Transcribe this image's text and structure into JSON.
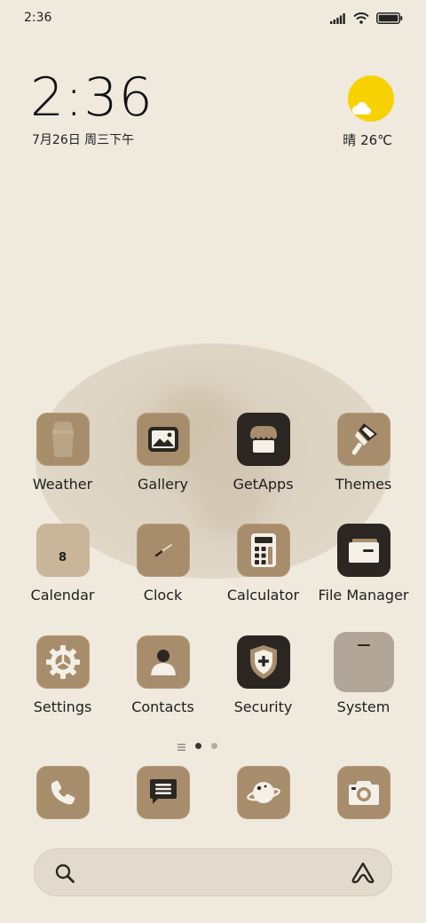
{
  "status_bar": {
    "time": "2:36"
  },
  "widget": {
    "time": "2:36",
    "date": "7月26日 周三下午",
    "weather": "晴 26℃"
  },
  "apps": [
    {
      "label": "Weather"
    },
    {
      "label": "Gallery"
    },
    {
      "label": "GetApps"
    },
    {
      "label": "Themes"
    },
    {
      "label": "Calendar",
      "day": "8"
    },
    {
      "label": "Clock"
    },
    {
      "label": "Calculator"
    },
    {
      "label": "File Manager"
    },
    {
      "label": "Settings"
    },
    {
      "label": "Contacts"
    },
    {
      "label": "Security"
    },
    {
      "label": "System"
    }
  ],
  "dock": [
    {
      "icon": "phone-icon"
    },
    {
      "icon": "messages-icon"
    },
    {
      "icon": "browser-icon"
    },
    {
      "icon": "camera-icon"
    }
  ],
  "colors": {
    "background": "#efe9de",
    "tile_brown": "#a88d6c",
    "tile_dark": "#2b2622",
    "sun": "#f7d200"
  }
}
